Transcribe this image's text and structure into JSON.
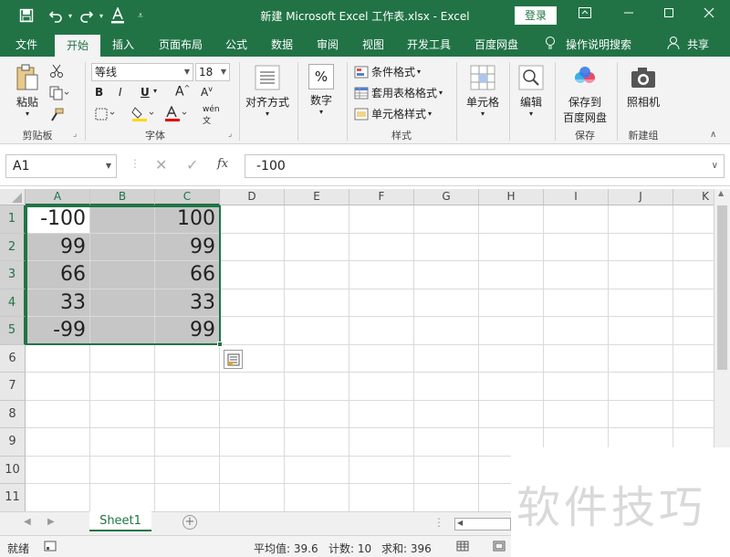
{
  "titlebar": {
    "title": "新建 Microsoft Excel 工作表.xlsx - Excel",
    "login": "登录",
    "accent": "#217346"
  },
  "tabs": [
    "文件",
    "开始",
    "插入",
    "页面布局",
    "公式",
    "数据",
    "审阅",
    "视图",
    "开发工具",
    "百度网盘",
    "操作说明搜索",
    "共享"
  ],
  "ribbon": {
    "clipboard": {
      "paste": "粘贴",
      "label": "剪贴板"
    },
    "font": {
      "name": "等线",
      "size": "18",
      "label": "字体",
      "bold": "B",
      "italic": "I",
      "underline": "U"
    },
    "alignment": {
      "label": "对齐方式"
    },
    "number": {
      "label": "数字",
      "symbol": "%"
    },
    "styles": {
      "cond": "条件格式",
      "table": "套用表格格式",
      "cell": "单元格样式",
      "label": "样式"
    },
    "cells": {
      "label": "单元格"
    },
    "editing": {
      "label": "编辑"
    },
    "save": {
      "btn_line1": "保存到",
      "btn_line2": "百度网盘",
      "label": "保存"
    },
    "camera": {
      "btn": "照相机",
      "label": "新建组"
    }
  },
  "formula_bar": {
    "name_box": "A1",
    "formula": "-100",
    "fx": "fx"
  },
  "columns": [
    "A",
    "B",
    "C",
    "D",
    "E",
    "F",
    "G",
    "H",
    "I",
    "J",
    "K"
  ],
  "rows": [
    "1",
    "2",
    "3",
    "4",
    "5",
    "6",
    "7",
    "8",
    "9",
    "10",
    "11"
  ],
  "cells": {
    "A": [
      "-100",
      "99",
      "66",
      "33",
      "-99"
    ],
    "C": [
      "100",
      "99",
      "66",
      "33",
      "99"
    ]
  },
  "sheet_tab": "Sheet1",
  "status": {
    "mode": "就绪",
    "average": "平均值: 39.6",
    "count": "计数: 10",
    "sum": "求和: 396"
  },
  "watermark": "软件技巧"
}
